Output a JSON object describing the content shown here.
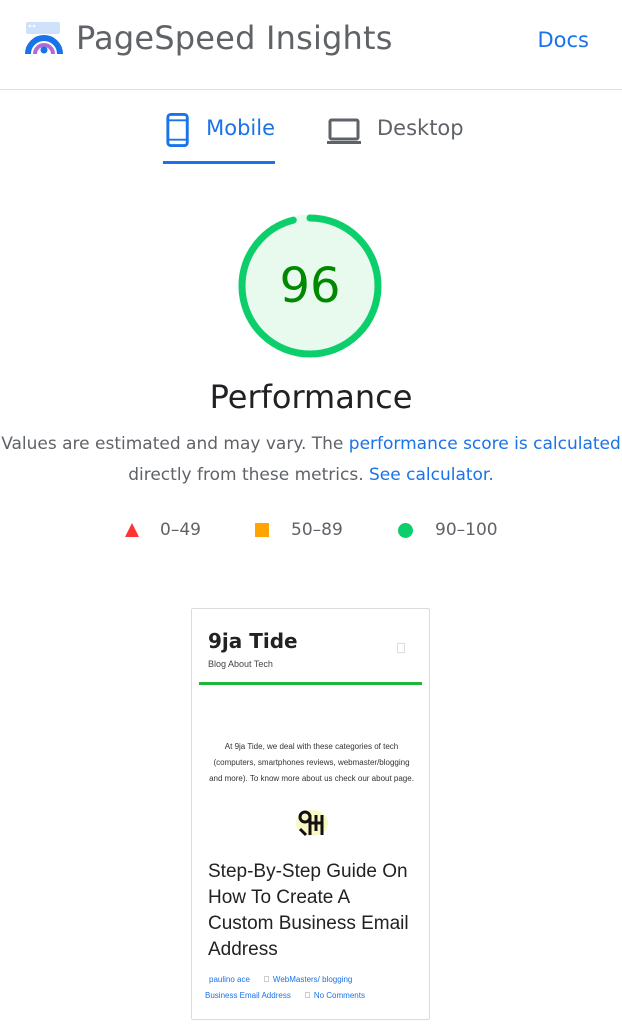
{
  "header": {
    "app_title": "PageSpeed Insights",
    "docs_label": "Docs",
    "logo_icon": "pagespeed-logo-icon"
  },
  "tabs": [
    {
      "label": "Mobile",
      "icon": "mobile-phone-icon",
      "selected": true
    },
    {
      "label": "Desktop",
      "icon": "laptop-icon",
      "selected": false
    }
  ],
  "colors": {
    "accent": "#1a73e8",
    "pass": "#0cce6b",
    "pass_text": "#008800",
    "average": "#ffa400",
    "fail": "#ff3333"
  },
  "gauge": {
    "score": "96",
    "score_value": 96,
    "title": "Performance"
  },
  "description": {
    "text_1": "Values are estimated and may vary. The ",
    "link_1": "performance score is calculated",
    "text_2": "directly from these metrics. ",
    "link_2": "See calculator",
    "text_3": "."
  },
  "legend": [
    {
      "range": "0–49",
      "shape": "triangle-icon"
    },
    {
      "range": "50–89",
      "shape": "square-icon"
    },
    {
      "range": "90–100",
      "shape": "circle-icon"
    }
  ],
  "screenshot": {
    "brand": "9ja Tide",
    "tagline": "Blog About Tech",
    "about": "At 9ja Tide, we deal with these categories of tech (computers, smartphones reviews, webmaster/blogging and more). To know more about us check our about page.",
    "headline": "Step-By-Step Guide On How To Create A Custom Business Email Address",
    "meta_author": "paulino ace",
    "meta_category": "WebMasters/ blogging",
    "meta_tag": "Business Email Address",
    "meta_comments": "No Comments"
  }
}
